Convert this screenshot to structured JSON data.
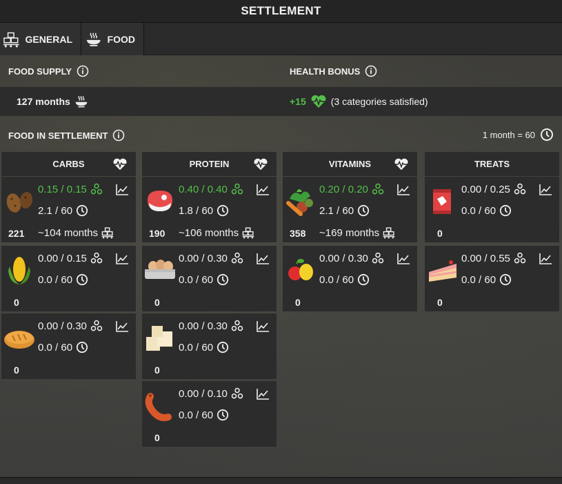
{
  "window": {
    "title": "SETTLEMENT"
  },
  "tabs": [
    {
      "label": "GENERAL",
      "icon": "warehouse-icon"
    },
    {
      "label": "FOOD",
      "icon": "food-bowl-icon"
    }
  ],
  "food_supply": {
    "label": "FOOD SUPPLY",
    "value": "127 months"
  },
  "health_bonus": {
    "label": "HEALTH BONUS",
    "value": "+15",
    "note": "(3 categories satisfied)"
  },
  "food_in_settlement": {
    "label": "FOOD IN SETTLEMENT",
    "rate": "1 month = 60"
  },
  "colors": {
    "green": "#54c04a",
    "panel": "#2c2c2c",
    "title": "#242424"
  },
  "columns": [
    {
      "name": "CARBS",
      "satisfied": true,
      "items": [
        {
          "icon": "potato-icon",
          "ratio": "0.15 / 0.15",
          "time": "2.1 / 60",
          "count": "221",
          "months": "~104 months",
          "met": true
        },
        {
          "icon": "corn-icon",
          "ratio": "0.00 / 0.15",
          "time": "0.0 / 60",
          "count": "0",
          "met": false
        },
        {
          "icon": "bread-icon",
          "ratio": "0.00 / 0.30",
          "time": "0.0 / 60",
          "count": "0",
          "met": false
        }
      ]
    },
    {
      "name": "PROTEIN",
      "satisfied": true,
      "items": [
        {
          "icon": "meat-icon",
          "ratio": "0.40 / 0.40",
          "time": "1.8 / 60",
          "count": "190",
          "months": "~106 months",
          "met": true
        },
        {
          "icon": "eggs-icon",
          "ratio": "0.00 / 0.30",
          "time": "0.0 / 60",
          "count": "0",
          "met": false
        },
        {
          "icon": "tofu-icon",
          "ratio": "0.00 / 0.30",
          "time": "0.0 / 60",
          "count": "0",
          "met": false
        },
        {
          "icon": "sausage-icon",
          "ratio": "0.00 / 0.10",
          "time": "0.0 / 60",
          "count": "0",
          "met": false
        }
      ]
    },
    {
      "name": "VITAMINS",
      "satisfied": true,
      "items": [
        {
          "icon": "vegetables-icon",
          "ratio": "0.20 / 0.20",
          "time": "2.1 / 60",
          "count": "358",
          "months": "~169 months",
          "met": true
        },
        {
          "icon": "fruit-icon",
          "ratio": "0.00 / 0.30",
          "time": "0.0 / 60",
          "count": "0",
          "met": false
        }
      ]
    },
    {
      "name": "TREATS",
      "satisfied": false,
      "items": [
        {
          "icon": "candy-icon",
          "ratio": "0.00 / 0.25",
          "time": "0.0 / 60",
          "count": "0",
          "met": false
        },
        {
          "icon": "cake-icon",
          "ratio": "0.00 / 0.55",
          "time": "0.0 / 60",
          "count": "0",
          "met": false
        }
      ]
    }
  ]
}
